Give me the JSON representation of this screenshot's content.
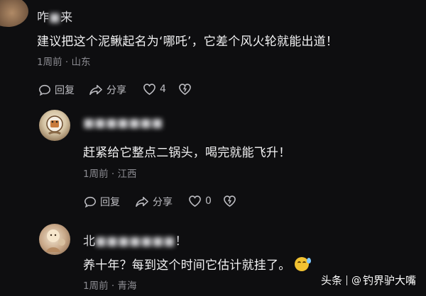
{
  "comments": [
    {
      "username_visible_start": "咋",
      "username_blurred": "■",
      "username_visible_end": "来",
      "text": "建议把这个泥鳅起名为‘哪吒’，它差个风火轮就能出道！",
      "time": "1周前",
      "location": "山东",
      "reply_label": "回复",
      "share_label": "分享",
      "like_count": "4"
    },
    {
      "username_blurred": "■■■■■■■",
      "text": "赶紧给它整点二锅头，喝完就能飞升！",
      "time": "1周前",
      "location": "江西",
      "reply_label": "回复",
      "share_label": "分享",
      "like_count": "0"
    },
    {
      "username_visible_start": "北",
      "username_blurred": "■■■■■■■",
      "username_visible_end": "！",
      "text": "养十年？每到这个时间它估计就挂了。",
      "time": "1周前",
      "location": "青海"
    }
  ],
  "meta_separator": "·",
  "watermark": {
    "brand": "头条",
    "at": "@",
    "account": "钓界驴大嘴"
  },
  "colors": {
    "background": "#0e0e10",
    "text": "#f2f2f3",
    "meta": "#8c8c92"
  },
  "icons": [
    "reply-icon",
    "share-icon",
    "like-icon",
    "dislike-icon",
    "sweat-smile-emoji-icon"
  ]
}
